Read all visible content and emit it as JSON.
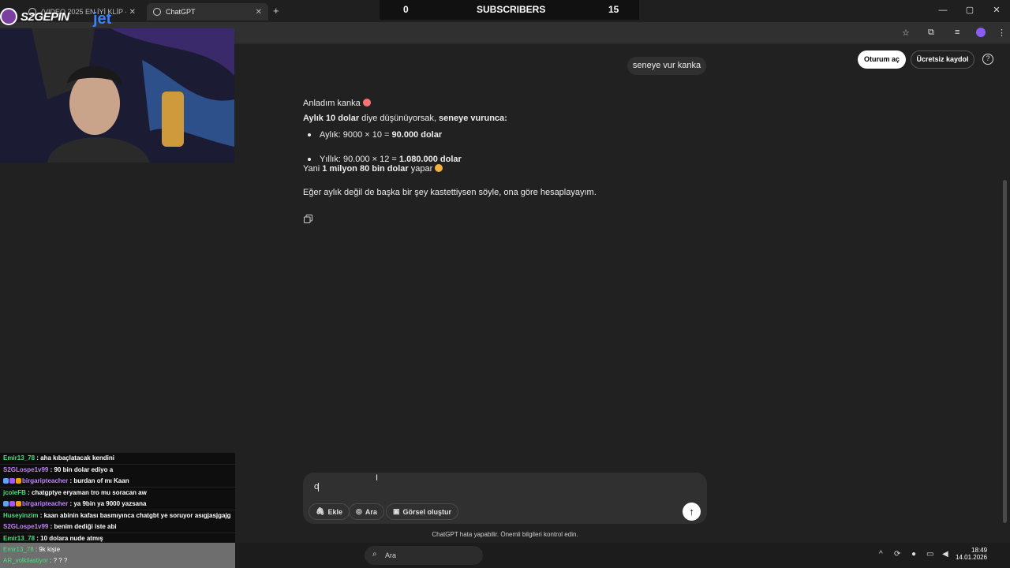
{
  "browser": {
    "tabs": [
      {
        "label": "(VIDEO 2025 EN İYİ KLİP - Tier List"
      },
      {
        "label": "ChatGPT"
      }
    ],
    "new_tab": "+",
    "window_controls": [
      "—",
      "▢",
      "✕"
    ]
  },
  "subscriber_bar": {
    "left_count": "0",
    "label": "SUBSCRIBERS",
    "right_count": "15"
  },
  "header": {
    "login_label": "Oturum aç",
    "signup_label": "Ücretsiz kaydol",
    "help_label": "?"
  },
  "conversation": {
    "user_message": "seneye vur kanka",
    "assistant": {
      "line1": "Anladım kanka",
      "line2_bold_a": "Aylık 10 dolar",
      "line2_normal": " diye düşünüyorsak, ",
      "line2_bold_b": "seneye vurunca:",
      "bullet1_normal": "Aylık: 9000 × 10 = ",
      "bullet1_bold": "90.000 dolar",
      "bullet2_normal": "Yıllık: 90.000 × 12 = ",
      "bullet2_bold": "1.080.000 dolar",
      "line5_prefix": "Yani ",
      "line5_bold": "1 milyon 80 bin dolar",
      "line5_suffix": " yapar",
      "line6": "Eğer aylık değil de başka bir şey kastettiysen söyle, ona göre hesaplayayım."
    }
  },
  "composer": {
    "input_value": "o",
    "attach_label": "Ekle",
    "search_label": "Ara",
    "image_label": "Görsel oluştur",
    "send_icon": "↑"
  },
  "disclaimer": "ChatGPT hata yapabilir. Önemli bilgileri kontrol edin.",
  "stream": {
    "brand": "S2GEPIN",
    "sponsor": "jet",
    "chat": [
      {
        "user": "Emir13_78",
        "color": "#4ade80",
        "message": " : aha kıbaçlatacak kendini"
      },
      {
        "user": "S2GLospe1v99",
        "color": "#c084fc",
        "message": " : 90 bin dolar ediyo a"
      },
      {
        "user": "birgaripteacher",
        "color": "#c084fc",
        "message": " : burdan of mı Kaan"
      },
      {
        "user": "jcoleFB",
        "color": "#4ade80",
        "message": " : chatgptye eryaman tro mu soracan aw"
      },
      {
        "user": "birgaripteacher",
        "color": "#c084fc",
        "message": " : ya 9bin ya 9000 yazsana"
      },
      {
        "user": "Huseyinzim",
        "color": "#4ade80",
        "message": " : kaan abinin kafası basmıyınca chatgbt ye soruyor asıgjasjgajg"
      },
      {
        "user": "S2GLospe1v99",
        "color": "#c084fc",
        "message": " : benim dediği iste abi"
      },
      {
        "user": "Emir13_78",
        "color": "#4ade80",
        "message": " : 10 dolara nude atmış"
      }
    ],
    "footer": [
      {
        "user": "Emir13_78",
        "message": " : 9k kişie"
      },
      {
        "user": "AR_volkilastiyor",
        "message": " : ? ? ?"
      }
    ]
  },
  "taskbar": {
    "search_label": "Ara",
    "time": "18:49",
    "date": "14.01.2026"
  }
}
